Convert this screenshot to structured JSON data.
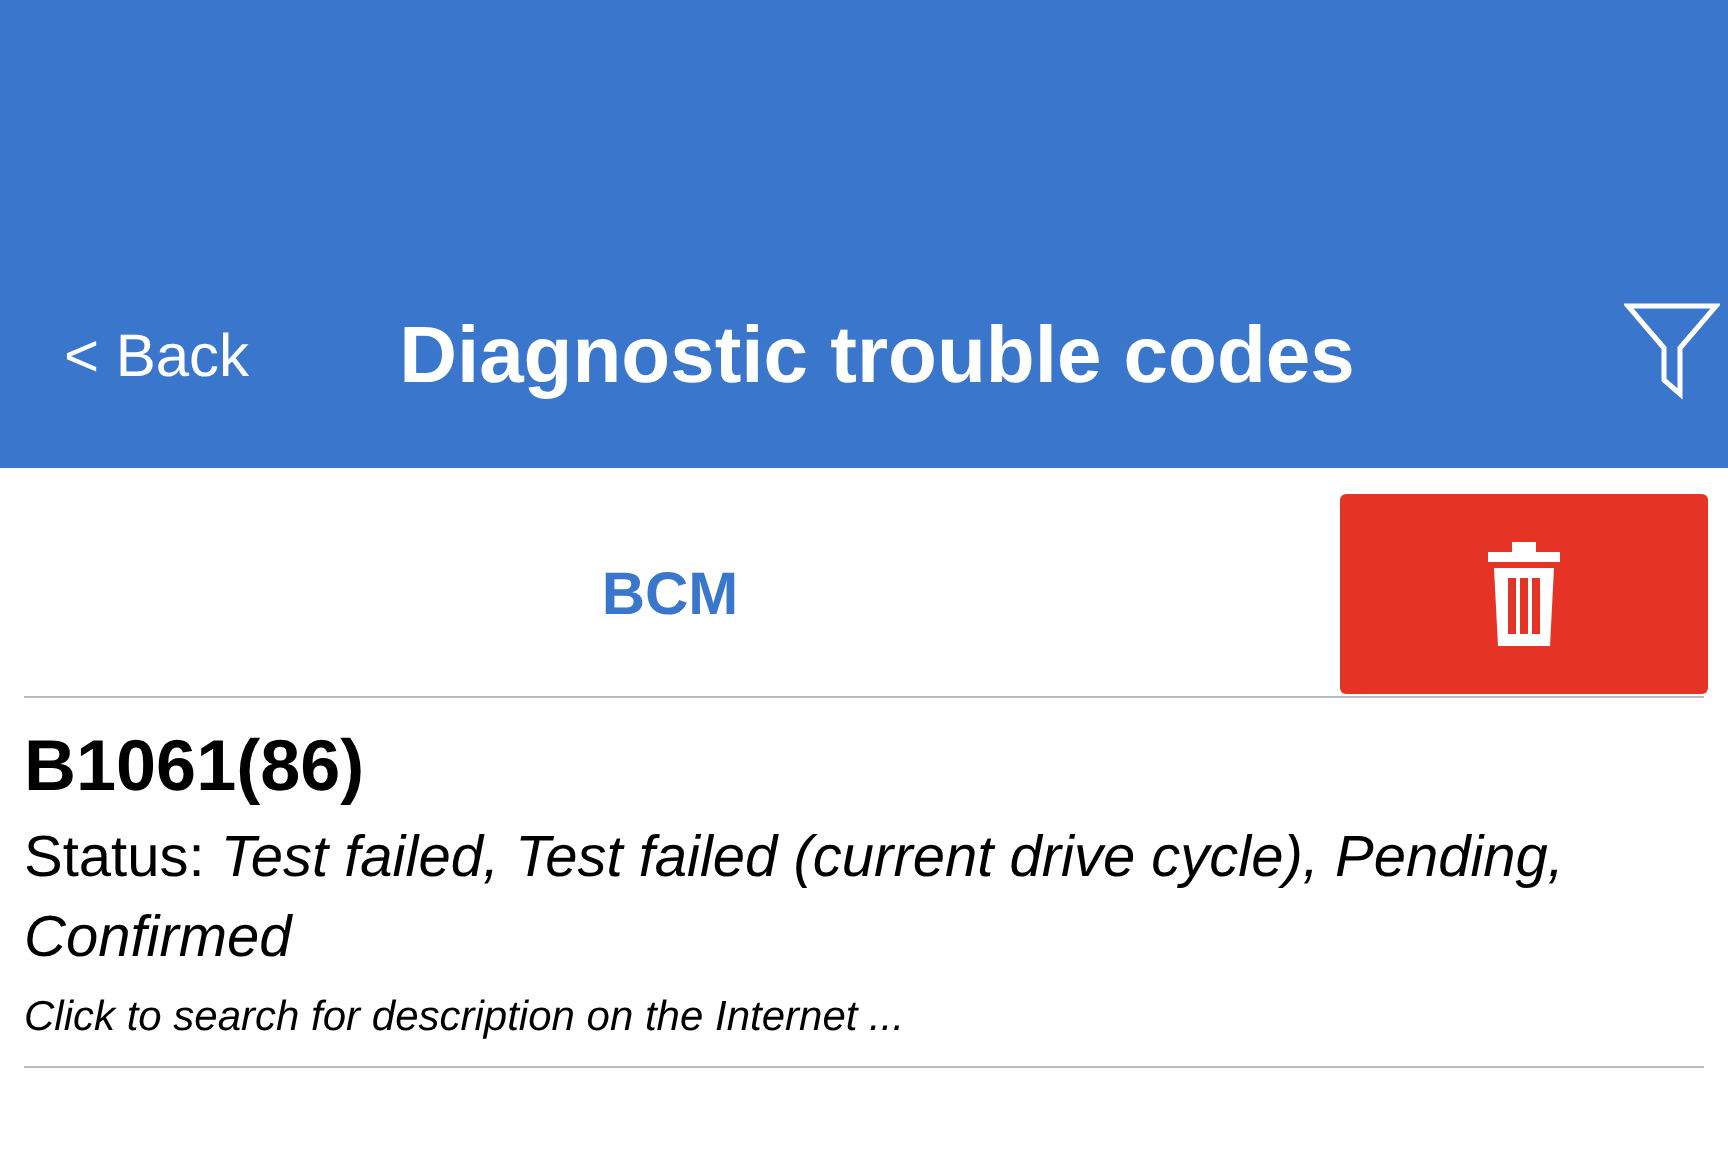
{
  "header": {
    "back": "< Back",
    "title": "Diagnostic trouble codes"
  },
  "module": {
    "name": "BCM"
  },
  "codes": [
    {
      "code": "B1061(86)",
      "status": "Status: *Test failed, Test failed (current drive cycle), Pending, Confirmed*",
      "hint": "Click to search for description on the Internet ..."
    }
  ]
}
